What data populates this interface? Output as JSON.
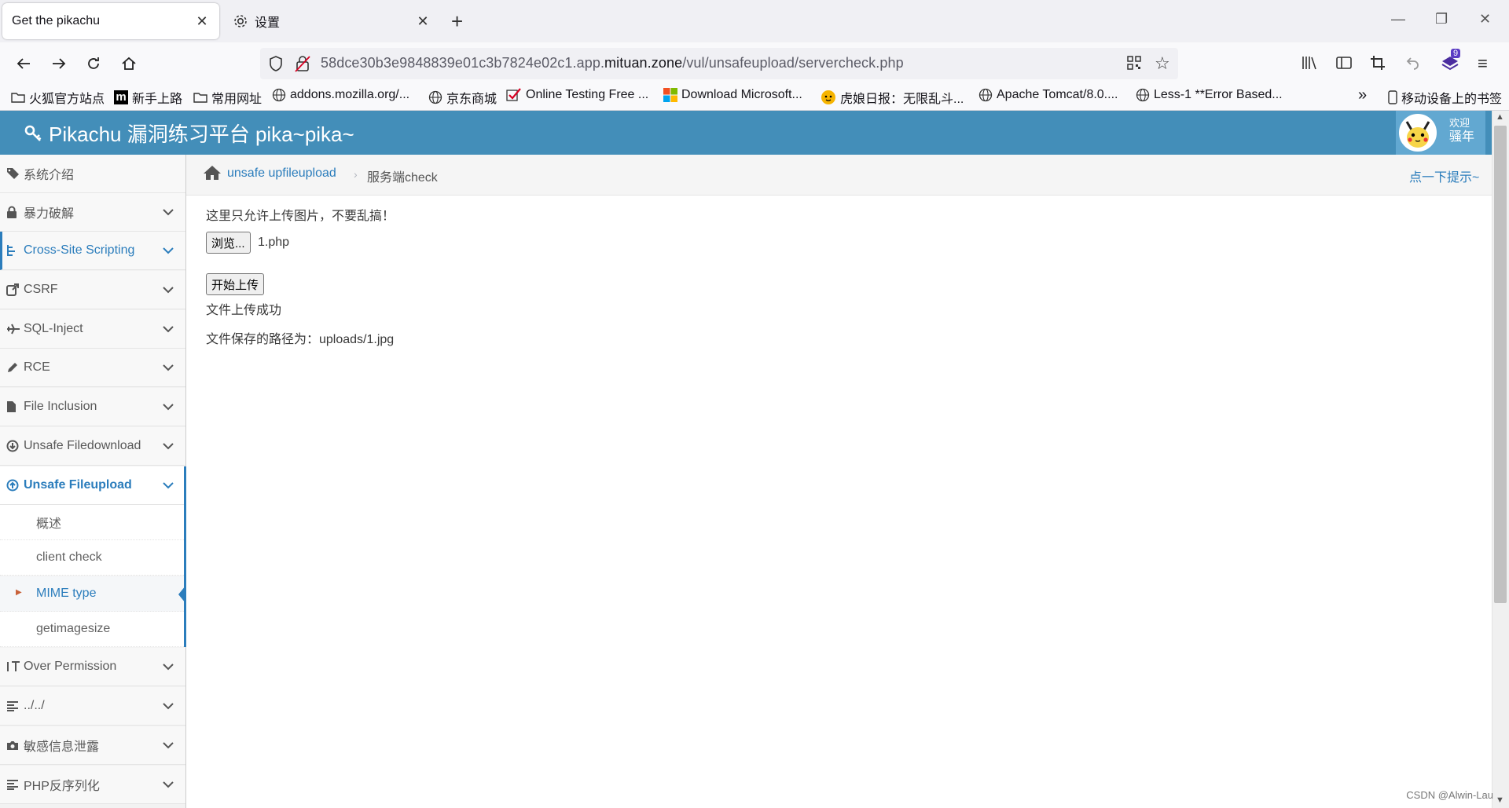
{
  "browser": {
    "tabs": [
      {
        "title": "Get the pikachu",
        "active": true
      },
      {
        "title": "设置",
        "active": false
      }
    ],
    "url": {
      "prefix": "58dce30b3e9848839e01c3b7824e02c1.app.",
      "domain": "mituan.zone",
      "path": "/vul/unsafeupload/servercheck.php"
    },
    "extension_badge": "9",
    "bookmarks": [
      {
        "label": "火狐官方站点",
        "icon": "folder-icon"
      },
      {
        "label": "新手上路",
        "icon": "m-logo-icon"
      },
      {
        "label": "常用网址",
        "icon": "folder-icon"
      },
      {
        "label": "addons.mozilla.org/...",
        "icon": "globe-icon"
      },
      {
        "label": "京东商城",
        "icon": "globe-icon"
      },
      {
        "label": "Online Testing Free ...",
        "icon": "check-icon"
      },
      {
        "label": "Download Microsoft...",
        "icon": "microsoft-icon"
      },
      {
        "label": "虎娘日报：无限乱斗...",
        "icon": "tiger-icon"
      },
      {
        "label": "Apache Tomcat/8.0....",
        "icon": "globe-icon"
      },
      {
        "label": "Less-1 **Error Based...",
        "icon": "globe-icon"
      }
    ],
    "mobile_bookmarks": "移动设备上的书签"
  },
  "header": {
    "title": "Pikachu 漏洞练习平台 pika~pika~",
    "welcome": "欢迎",
    "user": "骚年"
  },
  "sidebar": {
    "items": [
      {
        "label": "系统介绍",
        "icon": "tags-icon"
      },
      {
        "label": "暴力破解",
        "icon": "lock-icon"
      },
      {
        "label": "Cross-Site Scripting",
        "icon": "sitemap-icon"
      },
      {
        "label": "CSRF",
        "icon": "share-icon"
      },
      {
        "label": "SQL-Inject",
        "icon": "plane-icon"
      },
      {
        "label": "RCE",
        "icon": "pencil-icon"
      },
      {
        "label": "File Inclusion",
        "icon": "file-icon"
      },
      {
        "label": "Unsafe Filedownload",
        "icon": "download-icon"
      },
      {
        "label": "Unsafe Fileupload",
        "icon": "upload-icon"
      },
      {
        "label": "Over Permission",
        "icon": "text-height-icon"
      },
      {
        "label": "../../",
        "icon": "align-left-icon"
      },
      {
        "label": "敏感信息泄露",
        "icon": "camera-icon"
      },
      {
        "label": "PHP反序列化",
        "icon": "align-left-icon"
      }
    ],
    "submenu": [
      {
        "label": "概述"
      },
      {
        "label": "client check"
      },
      {
        "label": "MIME type"
      },
      {
        "label": "getimagesize"
      }
    ]
  },
  "breadcrumb": {
    "parent": "unsafe upfileupload",
    "current": "服务端check",
    "hint": "点一下提示~"
  },
  "content": {
    "notice": "这里只允许上传图片，不要乱搞！",
    "browse_button": "浏览...",
    "selected_file": "1.php",
    "upload_button": "开始上传",
    "result": "文件上传成功",
    "saved_path": "文件保存的路径为：uploads/1.jpg"
  },
  "watermark": "CSDN @Alwin-Lau"
}
